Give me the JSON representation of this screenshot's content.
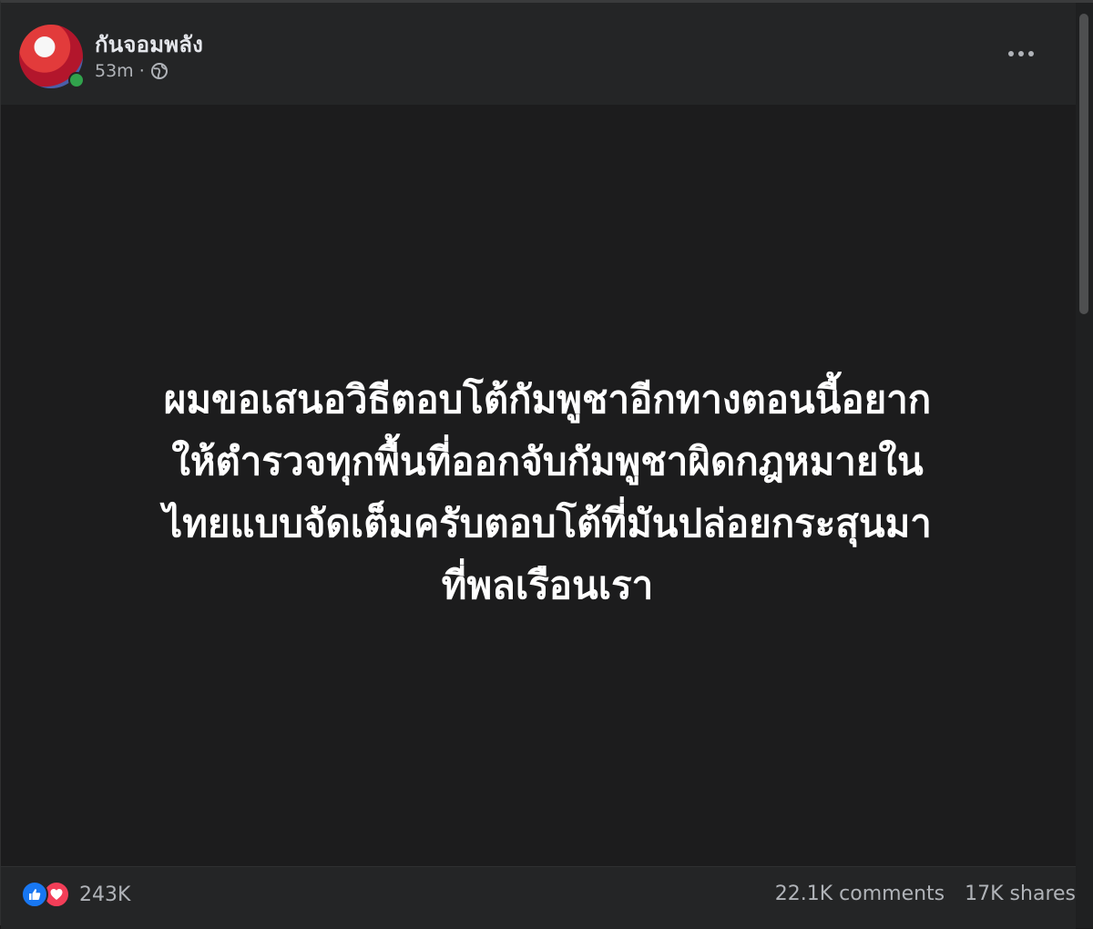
{
  "author": {
    "name": "กันจอมพลัง",
    "avatar": "profile-photo",
    "online": true
  },
  "meta": {
    "time": "53m",
    "separator": "·",
    "audience_icon": "globe-icon"
  },
  "header": {
    "more_icon": "more-options-icon"
  },
  "status": {
    "lines": [
      "ผมขอเสนอวิธีตอบโต้กัมพูชาอีกทางตอนนี้อยาก",
      "ให้ตำรวจทุกพื้นที่ออกจับกัมพูชาผิดกฎหมายใน",
      "ไทยแบบจัดเต็มครับตอบโต้ที่มันปล่อยกระสุนมา",
      "ที่พลเรือนเรา"
    ]
  },
  "footer": {
    "reactions_count": "243K",
    "reaction_icons": [
      "like-icon",
      "love-icon"
    ],
    "comments": "22.1K comments",
    "shares": "17K shares"
  },
  "colors": {
    "background": "#1c1c1d",
    "header": "#242526",
    "text_primary": "#e4e6eb",
    "text_secondary": "#b0b3b8",
    "like": "#1877f2",
    "love": "#f33e58",
    "online": "#31a24c"
  }
}
